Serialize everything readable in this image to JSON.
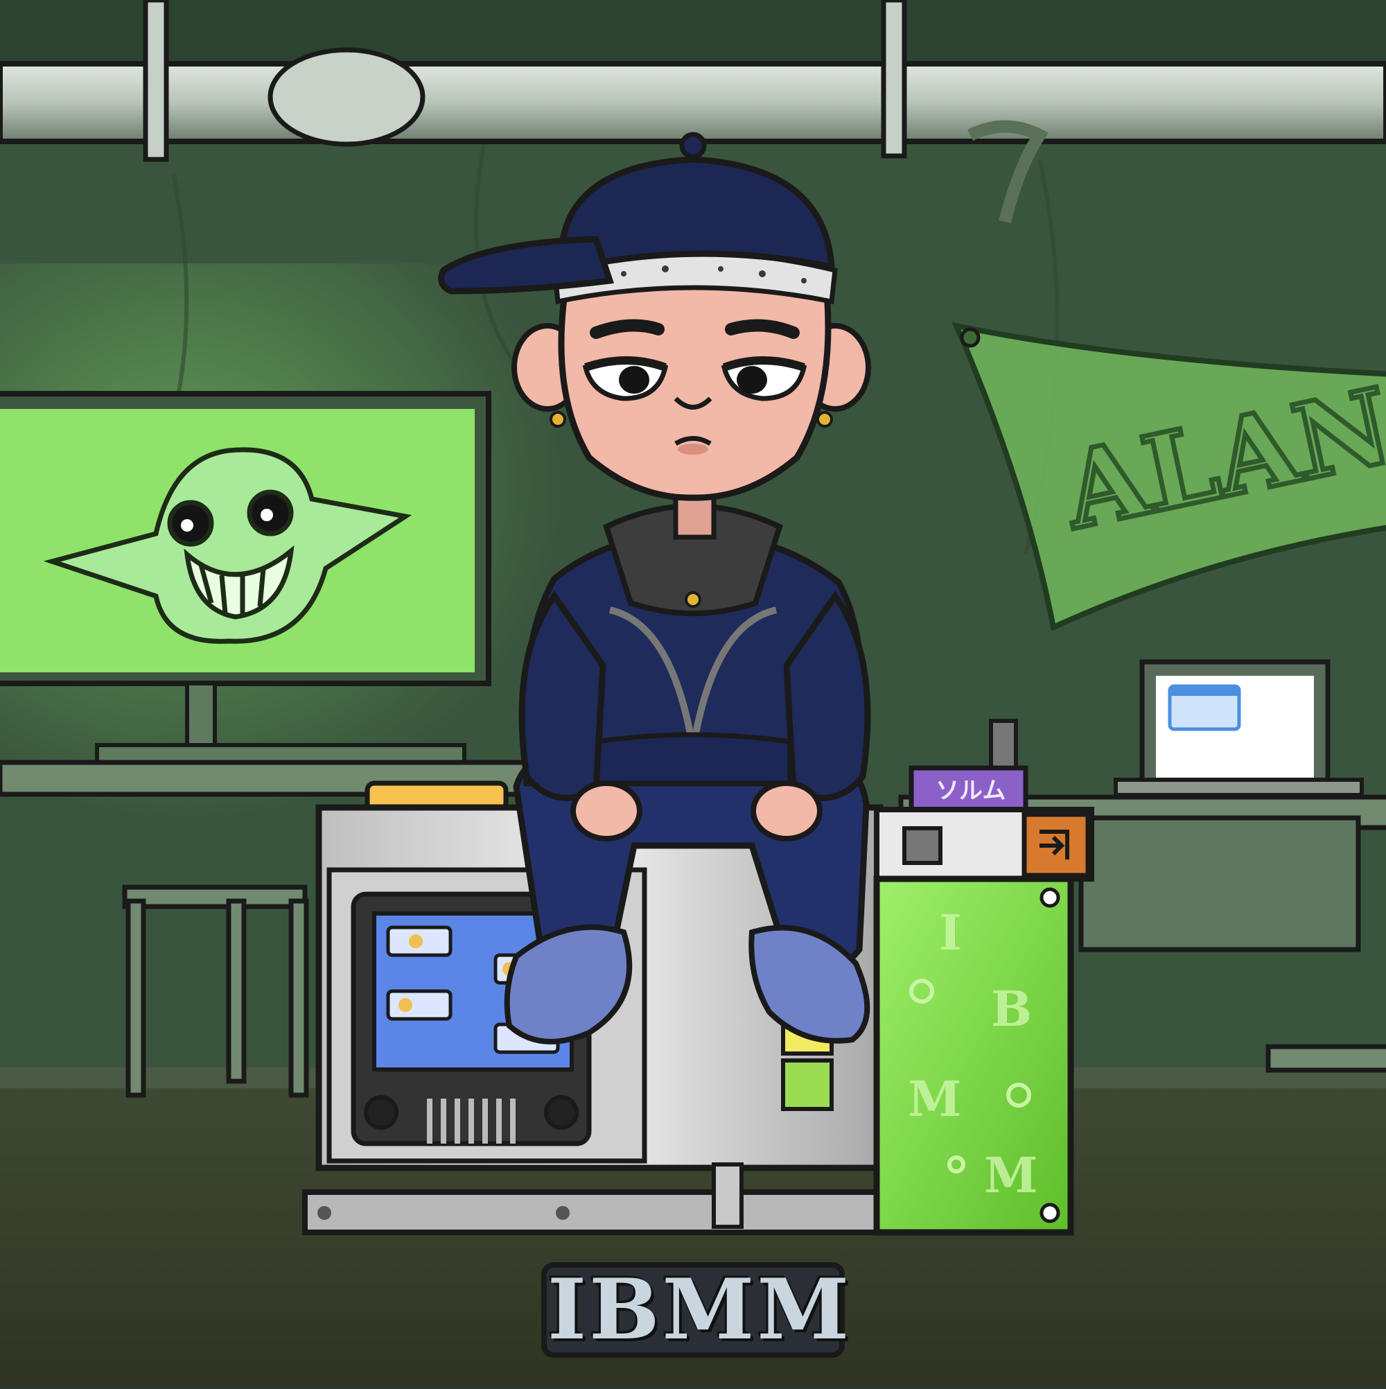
{
  "scene": {
    "brand_label": "IBMM",
    "sticker_label": "ソルム",
    "tank_letters": [
      "I",
      "B",
      "M",
      "M"
    ],
    "banner_text": "ALAN"
  },
  "colors": {
    "wall": "#3c5a40",
    "wall_dark": "#243424",
    "floor": "#3a3f28",
    "monitor_green": "#8fe36b",
    "tank_green": "#79d83c",
    "hoodie": "#1f2b5a",
    "cap": "#1d2753",
    "skin": "#f2b8a8",
    "machine": "#d8d8d8",
    "screen_blue": "#5b86e8",
    "sticker_purple": "#7a4fc0"
  },
  "icons": {
    "goblin": "goblin-drawing",
    "exit": "exit-arrow-icon",
    "window": "app-window-icon"
  }
}
